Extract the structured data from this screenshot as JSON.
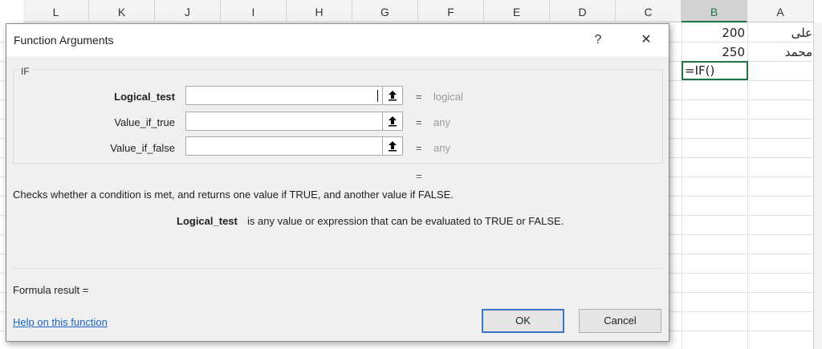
{
  "sheet": {
    "columns": [
      "L",
      "K",
      "J",
      "I",
      "H",
      "G",
      "F",
      "E",
      "D",
      "C",
      "B",
      "A"
    ],
    "selected_column": "B",
    "cells": {
      "a1": "علی",
      "b1": "200",
      "a2": "محمد",
      "b2": "250",
      "b3": "=IF()"
    }
  },
  "dialog": {
    "title": "Function Arguments",
    "help_glyph": "?",
    "close_glyph": "✕",
    "function_name": "IF",
    "args": [
      {
        "label": "Logical_test",
        "value": "",
        "result": "logical"
      },
      {
        "label": "Value_if_true",
        "value": "",
        "result": "any"
      },
      {
        "label": "Value_if_false",
        "value": "",
        "result": "any"
      }
    ],
    "equals": "=",
    "description": "Checks whether a condition is met, and returns one value if TRUE, and another value if FALSE.",
    "arg_help_name": "Logical_test",
    "arg_help_text": "is any value or expression that can be evaluated to TRUE or FALSE.",
    "formula_result_label": "Formula result =",
    "help_link": "Help on this function",
    "ok_label": "OK",
    "cancel_label": "Cancel"
  },
  "colors": {
    "accent": "#217346",
    "link": "#1a66c2",
    "ok_border": "#3a78c4"
  }
}
